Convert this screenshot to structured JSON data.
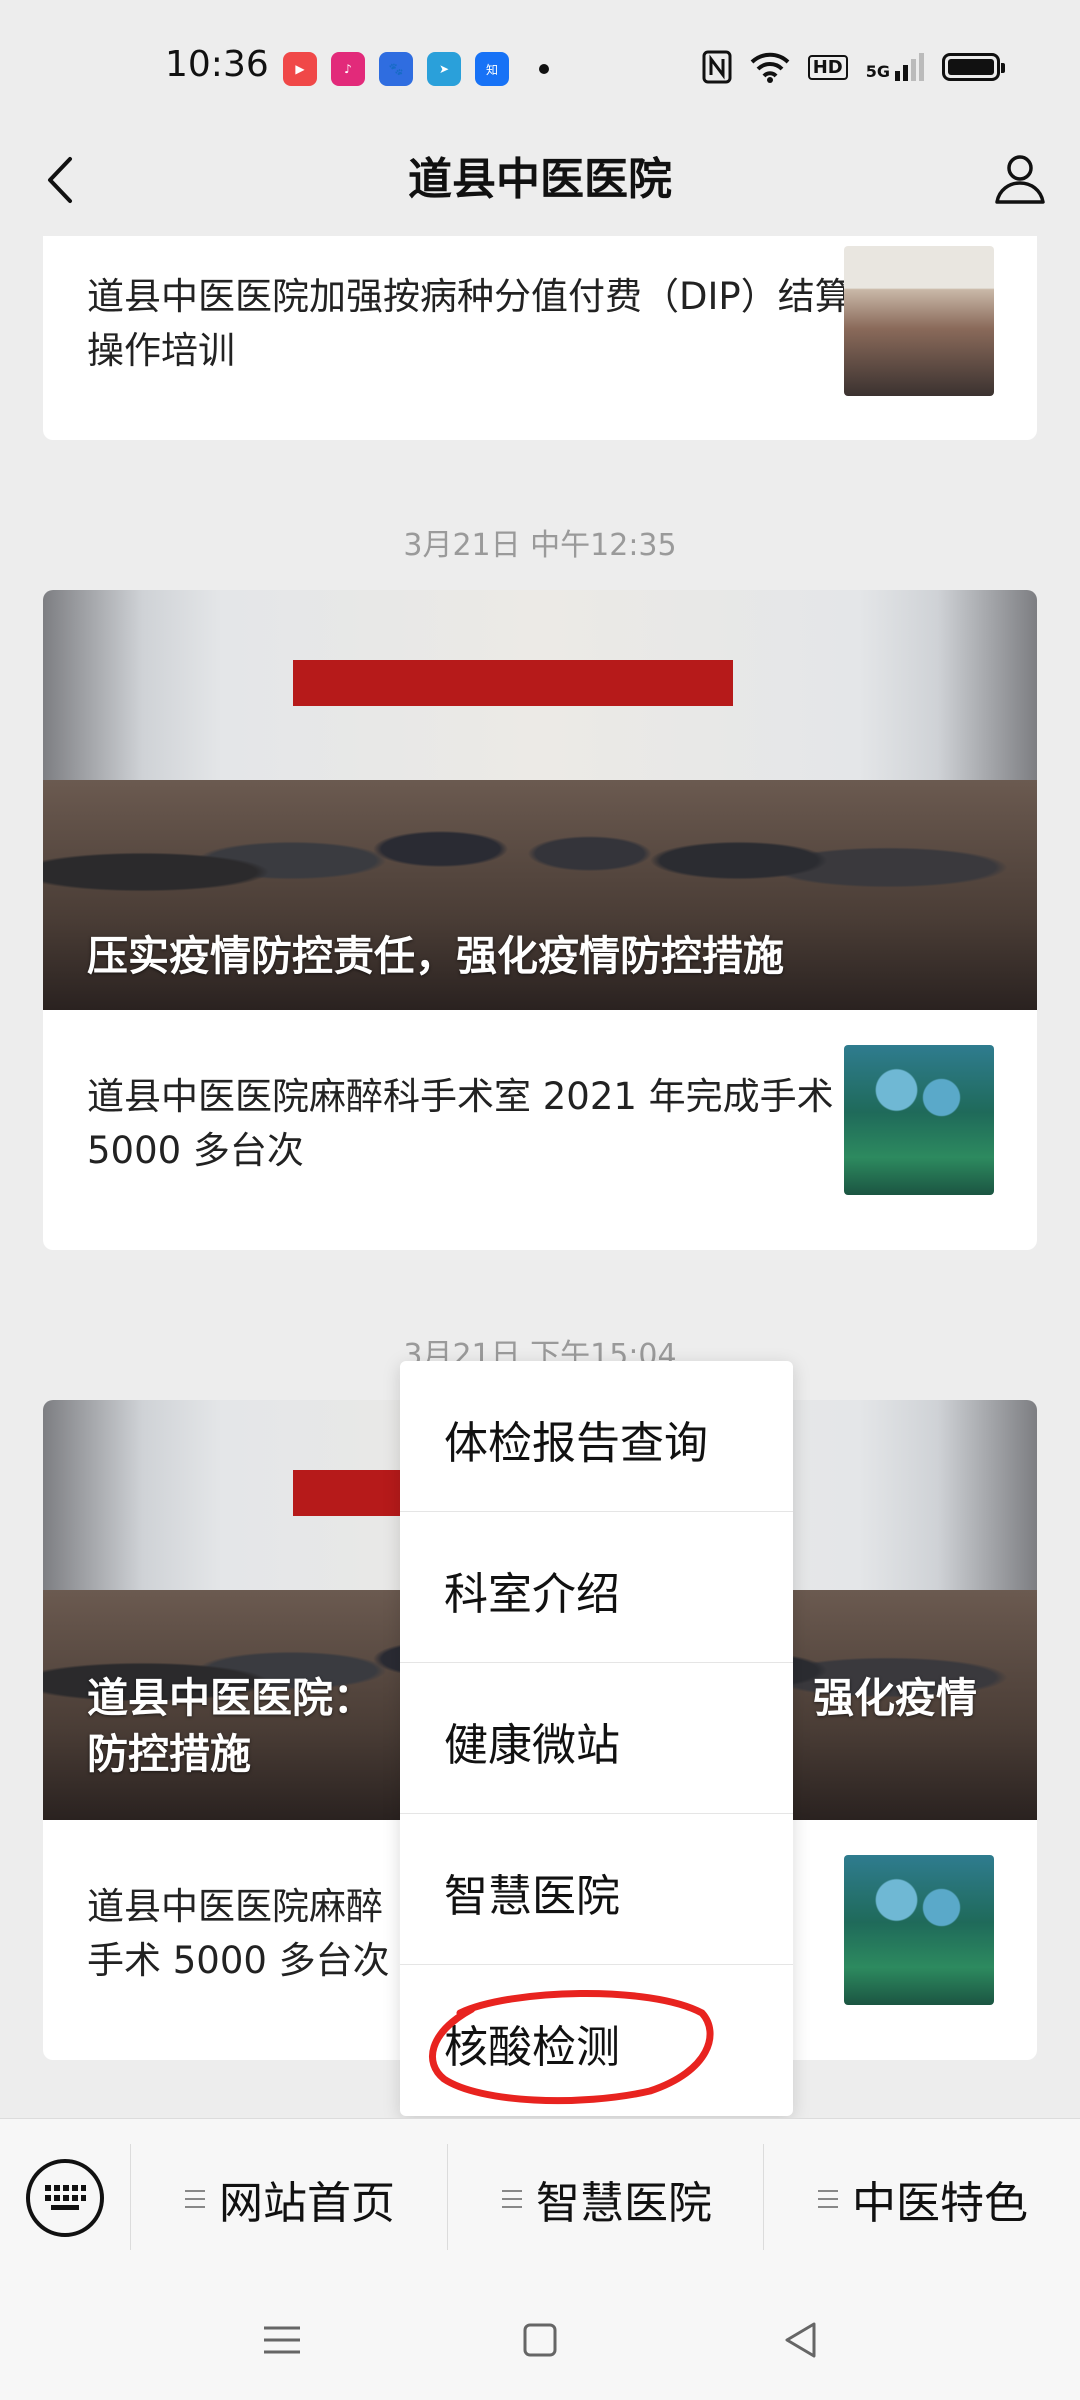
{
  "status_bar": {
    "time": "10:36",
    "apps": [
      {
        "icon": "video-app-icon",
        "color": "#f04848"
      },
      {
        "icon": "music-app-icon",
        "color": "#e22a7a"
      },
      {
        "icon": "baidu-icon",
        "color": "#2f6de0"
      },
      {
        "icon": "telegram-icon",
        "color": "#2aa0da"
      },
      {
        "icon": "zhihu-icon",
        "color": "#1772f6"
      }
    ],
    "signal_labels": {
      "hd": "HD",
      "network": "5G"
    }
  },
  "header": {
    "title": "道县中医医院"
  },
  "articles": {
    "top_card": {
      "text": "道县中医医院加强按病种分值付费（DIP）结算操作培训"
    },
    "group1": {
      "date": "3月21日 中午12:35",
      "hero_caption": "压实疫情防控责任，强化疫情防控措施",
      "item_text": "道县中医医院麻醉科手术室 2021 年完成手术 5000 多台次"
    },
    "group2": {
      "date": "3月21日 下午15:04",
      "hero_caption_left": "道县中医医院：",
      "hero_caption_left2": "防控措施",
      "hero_caption_right": "强化疫情",
      "item_text_left1": "道县中医医院麻醉",
      "item_text_left2": "手术 5000 多台次"
    }
  },
  "popup_menu": {
    "items": [
      "体检报告查询",
      "科室介绍",
      "健康微站",
      "智慧医院",
      "核酸检测"
    ]
  },
  "bottom_menu": {
    "tabs": [
      "网站首页",
      "智慧医院",
      "中医特色"
    ]
  },
  "colors": {
    "background": "#ededed",
    "card": "#ffffff",
    "date_text": "#9a9a9a",
    "highlight_circle": "#e8231f"
  }
}
